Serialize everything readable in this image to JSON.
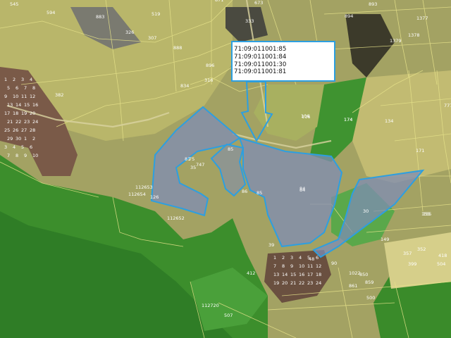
{
  "callout": {
    "cadastral_numbers": [
      "71:09:011001:85",
      "71:09:011001:84",
      "71:09:011001:30",
      "71:09:011001:81"
    ]
  },
  "parcels": {
    "selected": [
      "81",
      "84",
      "30",
      "85"
    ],
    "labels": [
      "545",
      "594",
      "883",
      "519",
      "326",
      "307",
      "871",
      "673",
      "333",
      "894",
      "893",
      "1377",
      "1378",
      "1379",
      "888",
      "834",
      "896",
      "316",
      "106",
      "134",
      "777",
      "174",
      "382",
      "35",
      "75",
      "747",
      "84",
      "86",
      "85",
      "112654",
      "126",
      "112652",
      "155",
      "149",
      "39",
      "352",
      "357",
      "399",
      "504",
      "418",
      "412",
      "1022",
      "850",
      "859",
      "861",
      "500",
      "507",
      "112653",
      "112720",
      "116",
      "171",
      "174",
      "155",
      "48",
      "90"
    ]
  },
  "colors": {
    "selection_fill": "#7f8cb4",
    "selection_stroke": "#2d9fe0",
    "parcel_line": "#e6e28a",
    "forest": "#3a8a2a",
    "field": "#b6b46c",
    "pointer": "#2d9fe0"
  }
}
